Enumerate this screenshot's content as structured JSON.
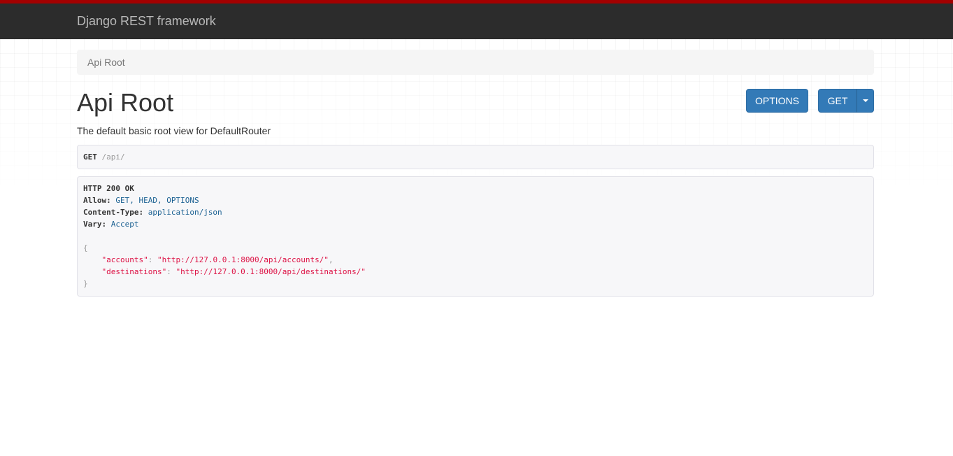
{
  "navbar": {
    "brand": "Django REST framework"
  },
  "breadcrumb": {
    "items": [
      "Api Root"
    ]
  },
  "page": {
    "title": "Api Root",
    "description": "The default basic root view for DefaultRouter"
  },
  "buttons": {
    "options_label": "OPTIONS",
    "get_label": "GET"
  },
  "request": {
    "method": "GET",
    "path": "/api/"
  },
  "response": {
    "status_line": "HTTP 200 OK",
    "headers": [
      {
        "name": "Allow:",
        "value": "GET, HEAD, OPTIONS"
      },
      {
        "name": "Content-Type:",
        "value": "application/json"
      },
      {
        "name": "Vary:",
        "value": "Accept"
      }
    ],
    "body_open": "{",
    "body_close": "}",
    "body": [
      {
        "key": "\"accounts\"",
        "value": "\"http://127.0.0.1:8000/api/accounts/\"",
        "trail": ","
      },
      {
        "key": "\"destinations\"",
        "value": "\"http://127.0.0.1:8000/api/destinations/\"",
        "trail": ""
      }
    ]
  },
  "colors": {
    "navbar_bg": "#2c2c2c",
    "navbar_accent": "#a30000",
    "button_primary": "#337ab7",
    "json_string": "#dd1144",
    "header_value": "#195f91"
  },
  "icons": {
    "dropdown": "caret-down-icon"
  }
}
